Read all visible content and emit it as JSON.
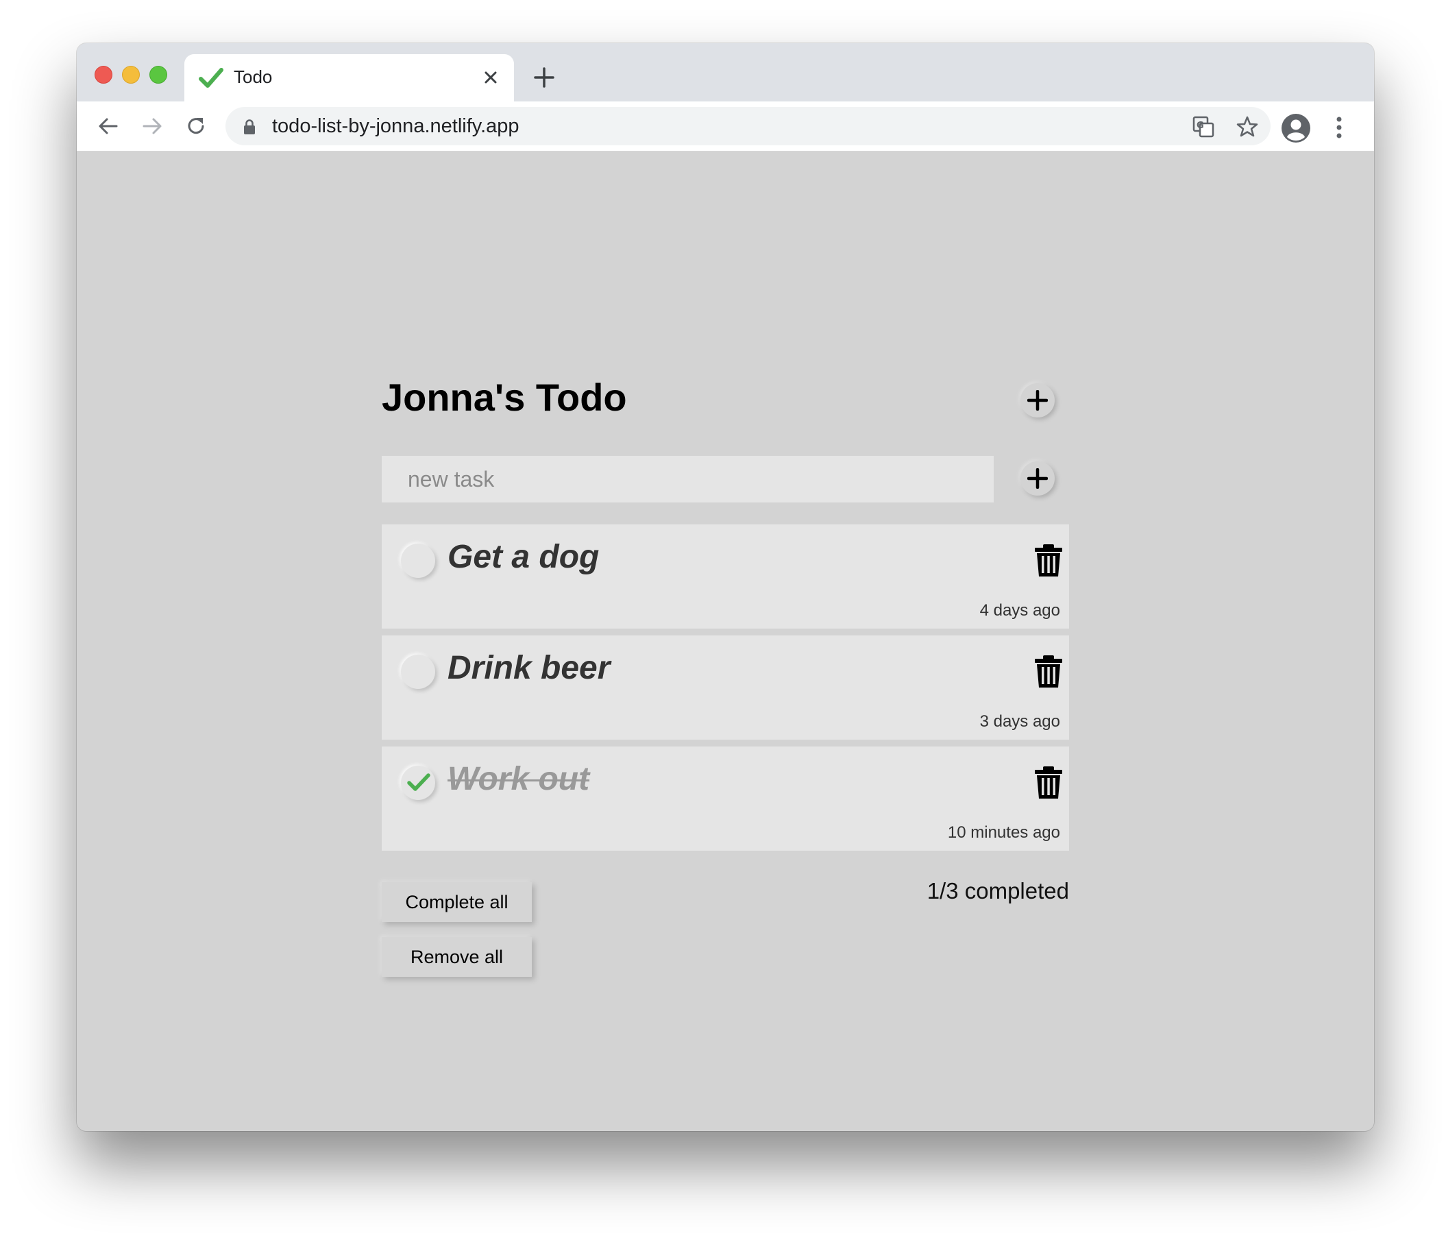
{
  "browser": {
    "tab_title": "Todo",
    "url": "todo-list-by-jonna.netlify.app"
  },
  "app": {
    "title": "Jonna's Todo",
    "input_placeholder": "new task",
    "todos": [
      {
        "text": "Get a dog",
        "time": "4 days ago",
        "completed": false
      },
      {
        "text": "Drink beer",
        "time": "3 days ago",
        "completed": false
      },
      {
        "text": "Work out",
        "time": "10 minutes ago",
        "completed": true
      }
    ],
    "complete_all_label": "Complete all",
    "remove_all_label": "Remove all",
    "completed_summary": "1/3 completed"
  },
  "colors": {
    "check_green": "#4caf50",
    "page_background": "#d3d3d3",
    "item_background": "#e5e5e5"
  }
}
